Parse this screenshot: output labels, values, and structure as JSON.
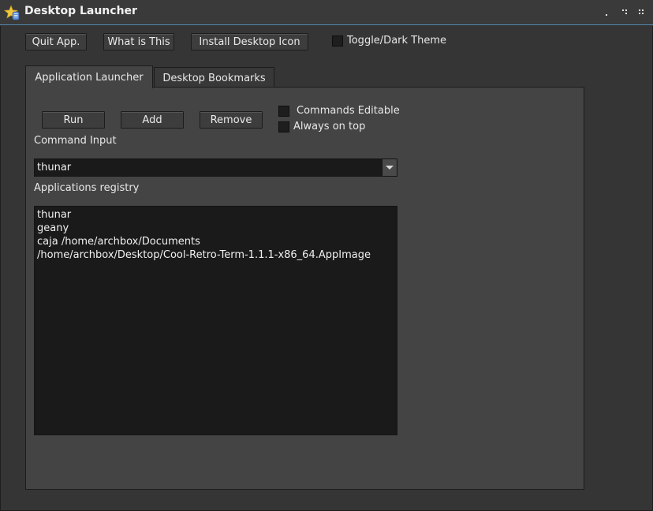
{
  "window": {
    "title": "Desktop Launcher",
    "app_icon": "star-shield-icon",
    "controls": [
      "minimize-icon",
      "maximize-icon",
      "close-icon"
    ]
  },
  "toolbar": {
    "quit_label": "Quit App.",
    "what_label": "What is This",
    "install_label": "Install Desktop Icon",
    "toggle_theme_label": "Toggle/Dark Theme",
    "toggle_theme_checked": false
  },
  "tabs": [
    {
      "label": "Application Launcher",
      "active": true
    },
    {
      "label": "Desktop Bookmarks",
      "active": false
    }
  ],
  "launcher": {
    "run_label": "Run",
    "add_label": "Add",
    "remove_label": "Remove",
    "commands_editable_label": "Commands Editable",
    "commands_editable_checked": false,
    "always_on_top_label": "Always on top",
    "always_on_top_checked": false,
    "command_input_label": "Command Input",
    "command_input_value": "thunar",
    "registry_label": "Applications registry",
    "registry_items": [
      "thunar",
      "geany",
      "caja /home/archbox/Documents",
      "/home/archbox/Desktop/Cool-Retro-Term-1.1.1-x86_64.AppImage"
    ]
  },
  "colors": {
    "background": "#353535",
    "panel": "#444444",
    "input_bg": "#1a1a1a",
    "accent": "#5b8fb9"
  }
}
